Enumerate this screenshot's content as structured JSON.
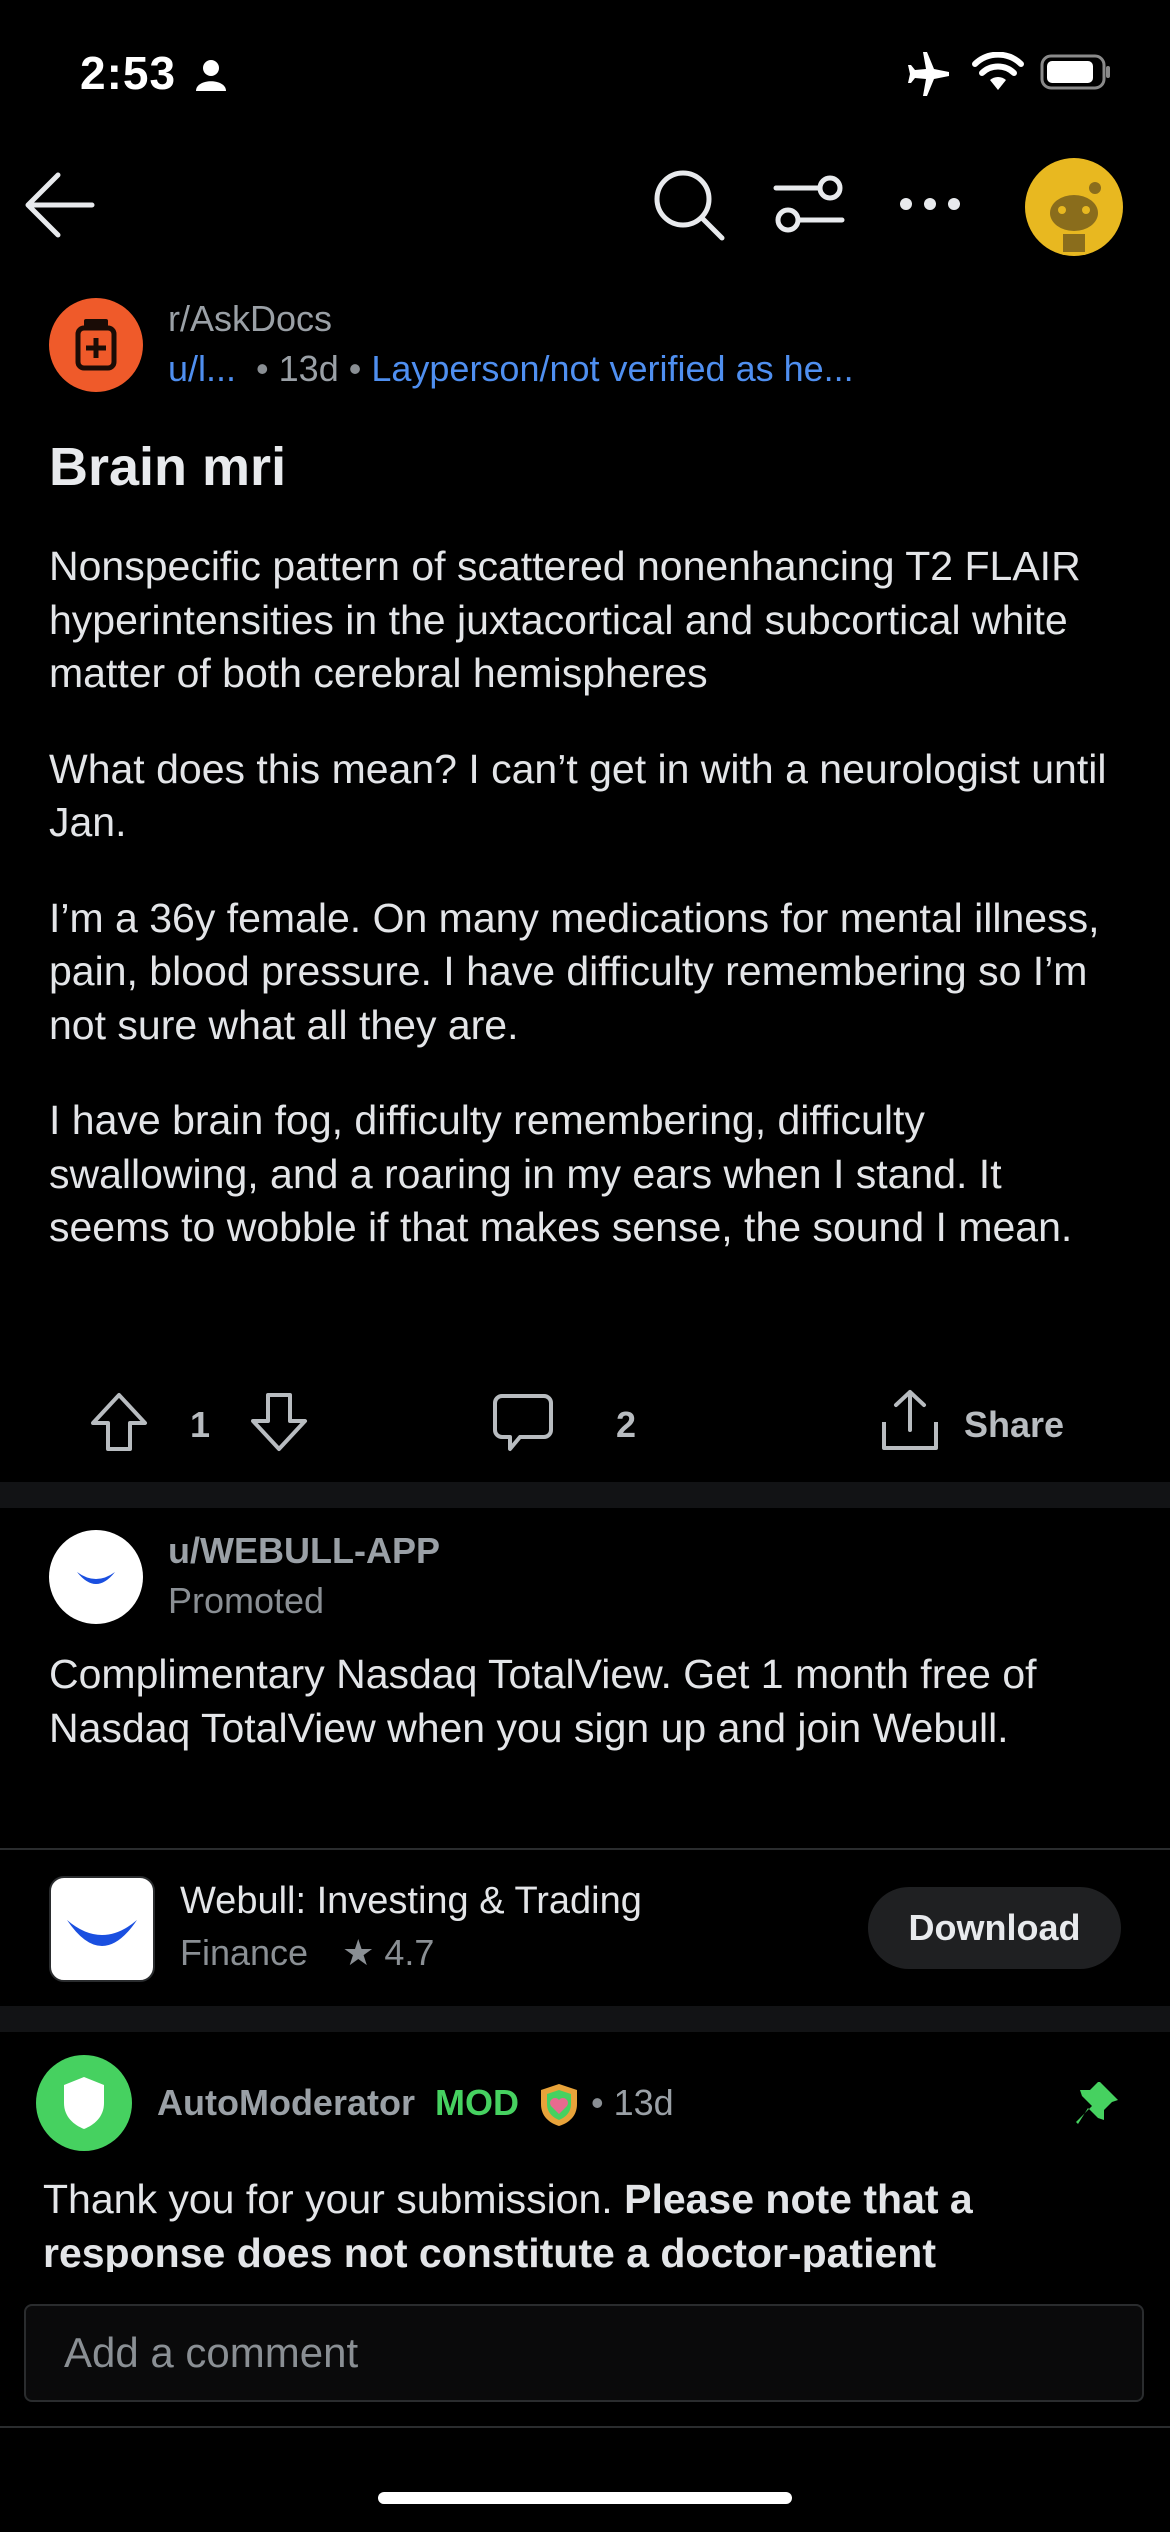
{
  "status_bar": {
    "time": "2:53"
  },
  "post": {
    "subreddit": "r/AskDocs",
    "user": "u/l...",
    "age": "13d",
    "flair": "Layperson/not verified as he...",
    "title": "Brain mri",
    "body": [
      "Nonspecific pattern of scattered nonenhancing T2 FLAIR hyperintensities in the juxtacortical and subcortical white matter of both cerebral hemispheres",
      "What does this mean? I can’t get in with a neurologist until Jan.",
      "I’m a 36y female. On many medications for mental illness, pain, blood pressure. I have difficulty remembering so I’m not sure what all they are.",
      "I have brain fog, difficulty remembering, difficulty swallowing, and a roaring in my ears when I stand. It seems to wobble if that makes sense, the sound I mean."
    ],
    "votes": "1",
    "comments": "2",
    "share_label": "Share"
  },
  "promo": {
    "user": "u/WEBULL-APP",
    "label": "Promoted",
    "text": "Complimentary Nasdaq TotalView. Get 1 month free of Nasdaq TotalView when you sign up and join Webull.",
    "app_name": "Webull: Investing & Trading",
    "app_category": "Finance",
    "app_rating": "4.7",
    "download_label": "Download"
  },
  "comment": {
    "author": "AutoModerator",
    "mod_badge": "MOD",
    "age": "13d",
    "text_plain": "Thank you for your submission. ",
    "text_bold": "Please note that a response does not constitute a doctor-patient"
  },
  "comment_input": {
    "placeholder": "Add a comment"
  },
  "colors": {
    "background": "#000000",
    "link_blue": "#4f8ff0",
    "mod_green": "#46d160",
    "subreddit_icon": "#ef5a2a",
    "webull_blue": "#1a4fe0"
  },
  "icons": [
    "back-icon",
    "search-icon",
    "filter-icon",
    "more-icon",
    "avatar-icon",
    "upvote-icon",
    "downvote-icon",
    "comment-icon",
    "share-icon",
    "star-icon",
    "pin-icon",
    "shield-icon"
  ]
}
